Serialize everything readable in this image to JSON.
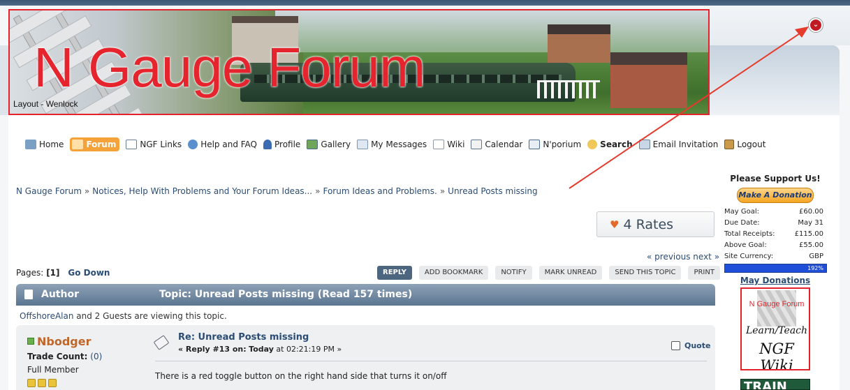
{
  "banner": {
    "title": "N Gauge Forum",
    "caption": "Layout - Wenlock"
  },
  "nav": [
    {
      "label": "Home"
    },
    {
      "label": "Forum"
    },
    {
      "label": "NGF Links"
    },
    {
      "label": "Help and FAQ"
    },
    {
      "label": "Profile"
    },
    {
      "label": "Gallery"
    },
    {
      "label": "My Messages"
    },
    {
      "label": "Wiki"
    },
    {
      "label": "Calendar"
    },
    {
      "label": "N'porium"
    },
    {
      "label": "Search"
    },
    {
      "label": "Email Invitation"
    },
    {
      "label": "Logout"
    }
  ],
  "breadcrumb": [
    "N Gauge Forum",
    "Notices, Help With Problems and Your Forum Ideas...",
    "Forum Ideas and Problems.",
    "Unread Posts missing"
  ],
  "breadcrumb_sep": "»",
  "rates": {
    "label": "4 Rates"
  },
  "pager": {
    "prev": "« previous",
    "next": "next »",
    "pages_label": "Pages:",
    "current_page": "[1]",
    "go_down": "Go Down"
  },
  "buttons": [
    "REPLY",
    "ADD BOOKMARK",
    "NOTIFY",
    "MARK UNREAD",
    "SEND THIS TOPIC",
    "PRINT"
  ],
  "topic_header": {
    "author": "Author",
    "topic": "Topic: Unread Posts missing  (Read 157 times)"
  },
  "viewing": {
    "user": "OffshoreAlan",
    "rest": " and 2 Guests are viewing this topic."
  },
  "post": {
    "author": "Nbodger",
    "trade_count_label": "Trade Count:",
    "trade_count_value": "(0)",
    "rank": "Full Member",
    "subject": "Re: Unread Posts missing",
    "reply_prefix": "« Reply #13 on:",
    "reply_day": "Today",
    "reply_time": "at 02:21:19 PM »",
    "quote_label": "Quote",
    "body": "There is a red toggle button on the right hand side that turns it on/off"
  },
  "sidebar": {
    "title": "Please Support Us!",
    "donate_button": "Make A Donation",
    "rows": [
      {
        "label": "May Goal:",
        "value": "£60.00"
      },
      {
        "label": "Due Date:",
        "value": "May 31"
      },
      {
        "label": "Total Receipts:",
        "value": "£115.00"
      },
      {
        "label": "Above Goal:",
        "value": "£55.00"
      },
      {
        "label": "Site Currency:",
        "value": "GBP"
      }
    ],
    "progress_percent": 192,
    "progress_label": "192%",
    "may_donations": "May Donations",
    "wiki_ad": {
      "title": "N Gauge Forum",
      "line1": "Learn/Teach",
      "line2": "NGF Wiki"
    },
    "bottom_ad": "TRAIN"
  },
  "colors": {
    "accent_red": "#e3222c",
    "link_blue": "#2b4c74",
    "forum_tab_orange": "#f5a23b",
    "header_bar": "#5b7590"
  },
  "icons": {
    "toggle": "chevron-down-icon"
  }
}
